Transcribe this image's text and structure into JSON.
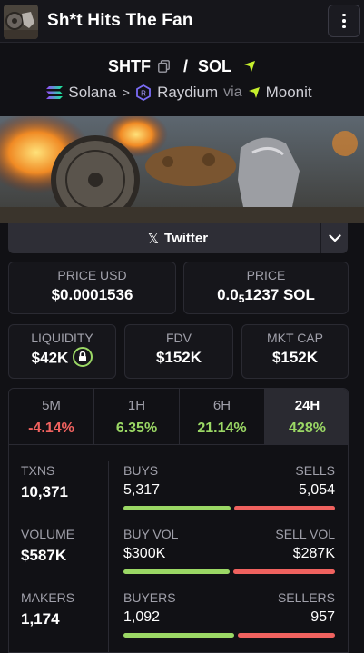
{
  "header": {
    "title": "Sh*t Hits The Fan"
  },
  "pair": {
    "base": "SHTF",
    "separator": "/",
    "quote": "SOL"
  },
  "chain": {
    "network": "Solana",
    "dex": "Raydium",
    "via_label": "via",
    "launchpad": "Moonit"
  },
  "twitter": {
    "label": "Twitter"
  },
  "price_usd": {
    "label": "PRICE USD",
    "value": "$0.0001536"
  },
  "price_native": {
    "label": "PRICE",
    "prefix": "0.0",
    "zeros": "5",
    "digits": "1237",
    "unit": "SOL"
  },
  "liquidity": {
    "label": "LIQUIDITY",
    "value": "$42K"
  },
  "fdv": {
    "label": "FDV",
    "value": "$152K"
  },
  "mktcap": {
    "label": "MKT CAP",
    "value": "$152K"
  },
  "tabs": [
    {
      "label": "5M",
      "value": "-4.14%"
    },
    {
      "label": "1H",
      "value": "6.35%"
    },
    {
      "label": "6H",
      "value": "21.14%"
    },
    {
      "label": "24H",
      "value": "428%"
    }
  ],
  "metrics": [
    {
      "label": "TXNS",
      "value": "10,371",
      "left_label": "BUYS",
      "left_value": "5,317",
      "right_label": "SELLS",
      "right_value": "5,054",
      "buy_ratio": 0.513
    },
    {
      "label": "VOLUME",
      "value": "$587K",
      "left_label": "BUY VOL",
      "left_value": "$300K",
      "right_label": "SELL VOL",
      "right_value": "$287K",
      "buy_ratio": 0.511
    },
    {
      "label": "MAKERS",
      "value": "1,174",
      "left_label": "BUYERS",
      "left_value": "1,092",
      "right_label": "SELLERS",
      "right_value": "957",
      "buy_ratio": 0.533
    }
  ],
  "colors": {
    "buy": "#9bd865",
    "sell": "#f0625f",
    "accent_moon": "#c6f02d"
  }
}
